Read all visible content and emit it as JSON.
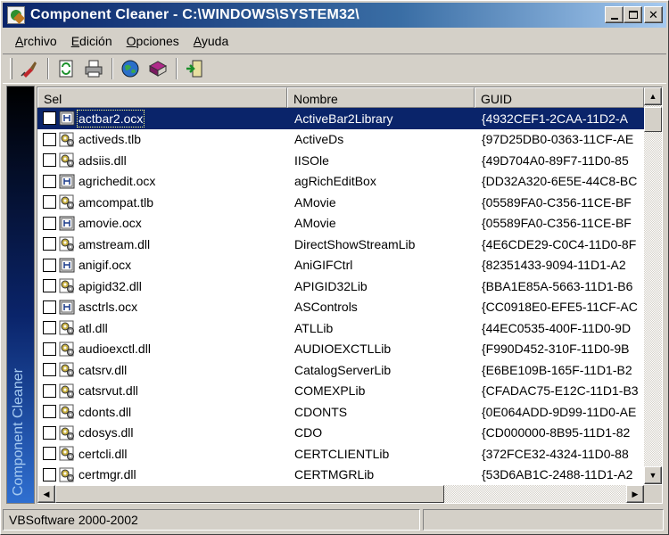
{
  "window": {
    "title": "Component Cleaner - C:\\WINDOWS\\SYSTEM32\\",
    "buttons": {
      "minimize": "_",
      "maximize": "□",
      "close": "✕"
    }
  },
  "menu": {
    "items": [
      {
        "first": "A",
        "rest": "rchivo"
      },
      {
        "first": "E",
        "rest": "dición"
      },
      {
        "first": "O",
        "rest": "pciones"
      },
      {
        "first": "A",
        "rest": "yuda"
      }
    ]
  },
  "toolbar": {
    "icons": [
      "clean-brush-icon",
      "refresh-icon",
      "print-icon",
      "web-globe-icon",
      "help-books-icon",
      "exit-door-icon"
    ]
  },
  "sidebar": {
    "label": "Component Cleaner"
  },
  "grid": {
    "columns": [
      "Sel",
      "Nombre",
      "GUID"
    ],
    "rows": [
      {
        "file": "actbar2.ocx",
        "name": "ActiveBar2Library",
        "guid": "{4932CEF1-2CAA-11D2-A",
        "kind": "ocx",
        "selected": true
      },
      {
        "file": "activeds.tlb",
        "name": "ActiveDs",
        "guid": "{97D25DB0-0363-11CF-AE",
        "kind": "dll"
      },
      {
        "file": "adsiis.dll",
        "name": "IISOle",
        "guid": "{49D704A0-89F7-11D0-85",
        "kind": "dll"
      },
      {
        "file": "agrichedit.ocx",
        "name": "agRichEditBox",
        "guid": "{DD32A320-6E5E-44C8-BC",
        "kind": "ocx"
      },
      {
        "file": "amcompat.tlb",
        "name": "AMovie",
        "guid": "{05589FA0-C356-11CE-BF",
        "kind": "dll"
      },
      {
        "file": "amovie.ocx",
        "name": "AMovie",
        "guid": "{05589FA0-C356-11CE-BF",
        "kind": "ocx"
      },
      {
        "file": "amstream.dll",
        "name": "DirectShowStreamLib",
        "guid": "{4E6CDE29-C0C4-11D0-8F",
        "kind": "dll"
      },
      {
        "file": "anigif.ocx",
        "name": "AniGIFCtrl",
        "guid": "{82351433-9094-11D1-A2",
        "kind": "ocx"
      },
      {
        "file": "apigid32.dll",
        "name": "APIGID32Lib",
        "guid": "{BBA1E85A-5663-11D1-B6",
        "kind": "dll"
      },
      {
        "file": "asctrls.ocx",
        "name": "ASControls",
        "guid": "{CC0918E0-EFE5-11CF-AC",
        "kind": "ocx"
      },
      {
        "file": "atl.dll",
        "name": "ATLLib",
        "guid": "{44EC0535-400F-11D0-9D",
        "kind": "dll"
      },
      {
        "file": "audioexctl.dll",
        "name": "AUDIOEXCTLLib",
        "guid": "{F990D452-310F-11D0-9B",
        "kind": "dll"
      },
      {
        "file": "catsrv.dll",
        "name": "CatalogServerLib",
        "guid": "{E6BE109B-165F-11D1-B2",
        "kind": "dll"
      },
      {
        "file": "catsrvut.dll",
        "name": "COMEXPLib",
        "guid": "{CFADAC75-E12C-11D1-B3",
        "kind": "dll"
      },
      {
        "file": "cdonts.dll",
        "name": "CDONTS",
        "guid": "{0E064ADD-9D99-11D0-AE",
        "kind": "dll"
      },
      {
        "file": "cdosys.dll",
        "name": "CDO",
        "guid": "{CD000000-8B95-11D1-82",
        "kind": "dll"
      },
      {
        "file": "certcli.dll",
        "name": "CERTCLIENTLib",
        "guid": "{372FCE32-4324-11D0-88",
        "kind": "dll"
      },
      {
        "file": "certmgr.dll",
        "name": "CERTMGRLib",
        "guid": "{53D6AB1C-2488-11D1-A2",
        "kind": "dll"
      }
    ]
  },
  "statusbar": {
    "text": "VBSoftware 2000-2002"
  },
  "colors": {
    "title_start": "#0a246a",
    "title_end": "#a6caf0",
    "selection": "#0a246a",
    "face": "#d4d0c8"
  }
}
